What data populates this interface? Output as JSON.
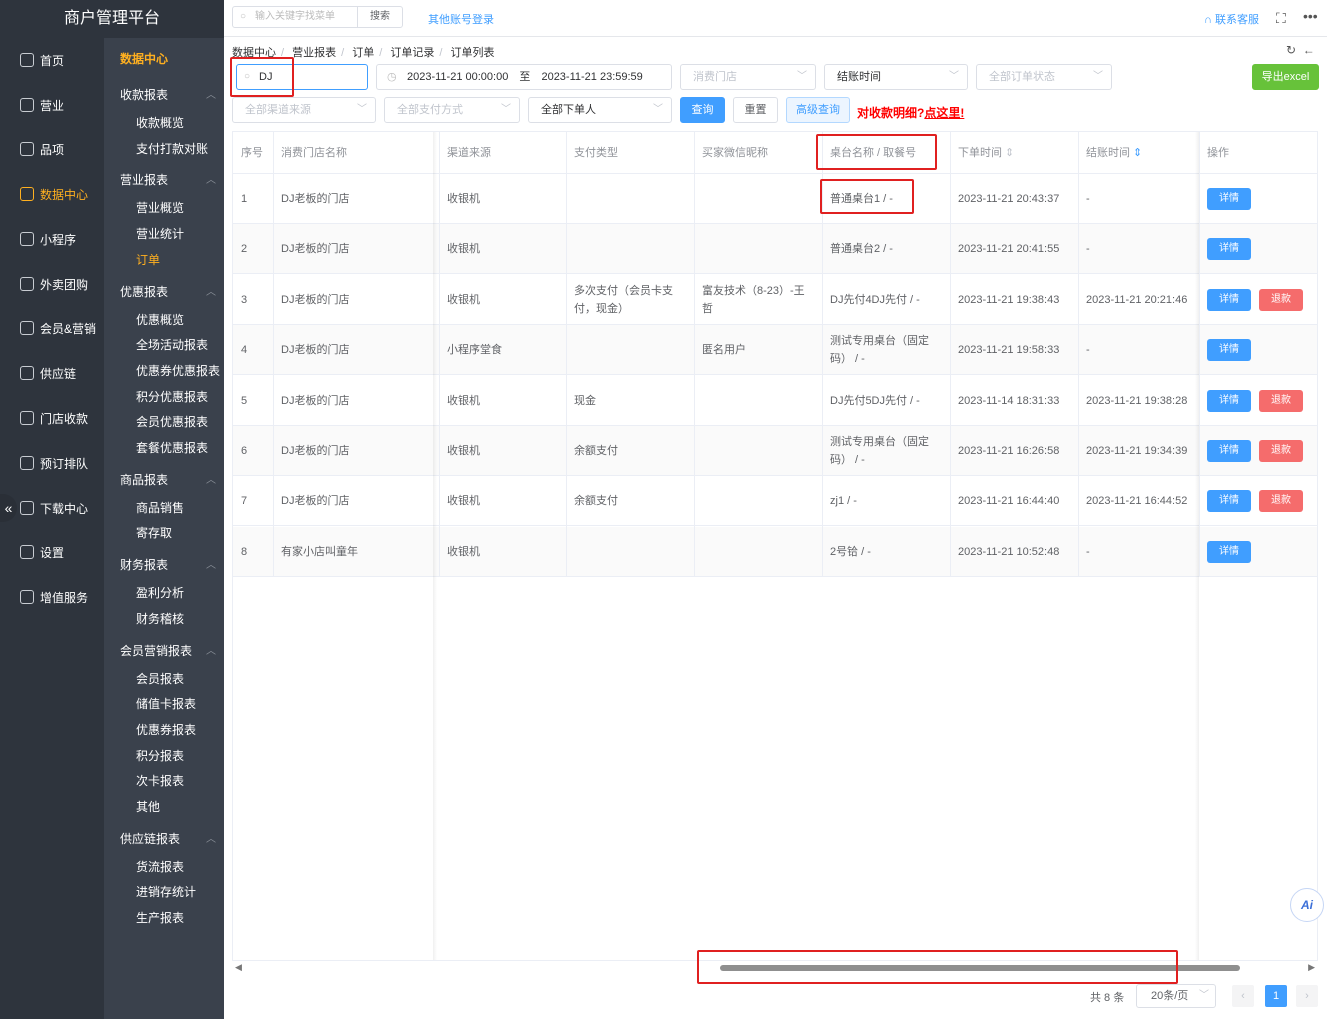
{
  "app": {
    "title": "商户管理平台"
  },
  "topbar": {
    "search_placeholder": "输入关键字找菜单",
    "search_btn": "搜索",
    "other_login": "其他账号登录",
    "contact": "联系客服",
    "fullscreen_glyph": "⛶",
    "more_glyph": "•••"
  },
  "nav1": [
    {
      "label": "首页",
      "icon": "home-icon"
    },
    {
      "label": "营业",
      "icon": "business-icon"
    },
    {
      "label": "品项",
      "icon": "goods-icon"
    },
    {
      "label": "数据中心",
      "icon": "share-icon",
      "active": true
    },
    {
      "label": "小程序",
      "icon": "phone-icon"
    },
    {
      "label": "外卖团购",
      "icon": "delivery-icon"
    },
    {
      "label": "会员&营销",
      "icon": "user-icon"
    },
    {
      "label": "供应链",
      "icon": "truck-icon"
    },
    {
      "label": "门店收款",
      "icon": "coin-icon"
    },
    {
      "label": "预订排队",
      "icon": "clock-icon"
    },
    {
      "label": "下载中心",
      "icon": "download-icon"
    },
    {
      "label": "设置",
      "icon": "gear-icon"
    },
    {
      "label": "增值服务",
      "icon": "alarm-icon"
    }
  ],
  "nav2": {
    "title": "数据中心",
    "groups": [
      {
        "label": "收款报表",
        "items": [
          "收款概览",
          "支付打款对账"
        ]
      },
      {
        "label": "营业报表",
        "items": [
          "营业概览",
          "营业统计",
          "订单"
        ]
      },
      {
        "label": "优惠报表",
        "items": [
          "优惠概览",
          "全场活动报表",
          "优惠券优惠报表",
          "积分优惠报表",
          "会员优惠报表",
          "套餐优惠报表"
        ]
      },
      {
        "label": "商品报表",
        "items": [
          "商品销售",
          "寄存取"
        ]
      },
      {
        "label": "财务报表",
        "items": [
          "盈利分析",
          "财务稽核"
        ]
      },
      {
        "label": "会员营销报表",
        "items": [
          "会员报表",
          "储值卡报表",
          "优惠券报表",
          "积分报表",
          "次卡报表",
          "其他"
        ]
      },
      {
        "label": "供应链报表",
        "items": [
          "货流报表",
          "进销存统计",
          "生产报表"
        ]
      }
    ],
    "active_item": "订单"
  },
  "breadcrumb": [
    "数据中心",
    "营业报表",
    "订单",
    "订单记录",
    "订单列表"
  ],
  "filters": {
    "keyword": "DJ",
    "date_start": "2023-11-21 00:00:00",
    "date_sep": "至",
    "date_end": "2023-11-21 23:59:59",
    "store_placeholder": "消费门店",
    "time_type": "结账时间",
    "order_status_placeholder": "全部订单状态",
    "channel_placeholder": "全部渠道来源",
    "payment_placeholder": "全部支付方式",
    "orderer": "全部下单人",
    "query_btn": "查询",
    "reset_btn": "重置",
    "advanced_btn": "高级查询",
    "export_btn": "导出excel",
    "hint_text": "对收款明细?",
    "hint_link": "点这里!"
  },
  "table": {
    "headers": [
      "序号",
      "消费门店名称",
      "渠道来源",
      "支付类型",
      "买家微信昵称",
      "桌台名称 / 取餐号",
      "下单时间",
      "结账时间",
      "操作"
    ],
    "detail_label": "详情",
    "refund_label": "退款",
    "rows": [
      {
        "no": "1",
        "store": "DJ老板的门店",
        "channel": "收银机",
        "pay": "",
        "buyer": "",
        "table": "普通桌台1 / -",
        "order_time": "2023-11-21 20:43:37",
        "close_time": "-",
        "refund": false
      },
      {
        "no": "2",
        "store": "DJ老板的门店",
        "channel": "收银机",
        "pay": "",
        "buyer": "",
        "table": "普通桌台2 / -",
        "order_time": "2023-11-21 20:41:55",
        "close_time": "-",
        "refund": false
      },
      {
        "no": "3",
        "store": "DJ老板的门店",
        "channel": "收银机",
        "pay": "多次支付（会员卡支付，现金）",
        "buyer": "富友技术（8-23）-王哲",
        "table": "DJ先付4DJ先付 / -",
        "order_time": "2023-11-21 19:38:43",
        "close_time": "2023-11-21 20:21:46",
        "refund": true
      },
      {
        "no": "4",
        "store": "DJ老板的门店",
        "channel": "小程序堂食",
        "pay": "",
        "buyer": "匿名用户",
        "table": "测试专用桌台（固定码） / -",
        "order_time": "2023-11-21 19:58:33",
        "close_time": "-",
        "refund": false
      },
      {
        "no": "5",
        "store": "DJ老板的门店",
        "channel": "收银机",
        "pay": "现金",
        "buyer": "",
        "table": "DJ先付5DJ先付 / -",
        "order_time": "2023-11-14 18:31:33",
        "close_time": "2023-11-21 19:38:28",
        "refund": true
      },
      {
        "no": "6",
        "store": "DJ老板的门店",
        "channel": "收银机",
        "pay": "余额支付",
        "buyer": "",
        "table": "测试专用桌台（固定码） / -",
        "order_time": "2023-11-21 16:26:58",
        "close_time": "2023-11-21 19:34:39",
        "refund": true
      },
      {
        "no": "7",
        "store": "DJ老板的门店",
        "channel": "收银机",
        "pay": "余额支付",
        "buyer": "",
        "table": "zj1 / -",
        "order_time": "2023-11-21 16:44:40",
        "close_time": "2023-11-21 16:44:52",
        "refund": true
      },
      {
        "no": "8",
        "store": "有家小店叫童年",
        "channel": "收银机",
        "pay": "",
        "buyer": "",
        "table": "2号铪 / -",
        "order_time": "2023-11-21 10:52:48",
        "close_time": "-",
        "refund": false
      }
    ]
  },
  "pager": {
    "total": "共 8 条",
    "size": "20条/页",
    "current": "1"
  },
  "ai_label": "Ai",
  "colors": {
    "accent": "#409eff",
    "active_nav": "#ffb020",
    "danger": "#f56c6c",
    "success": "#67c23a",
    "highlight_box": "#e02020"
  }
}
